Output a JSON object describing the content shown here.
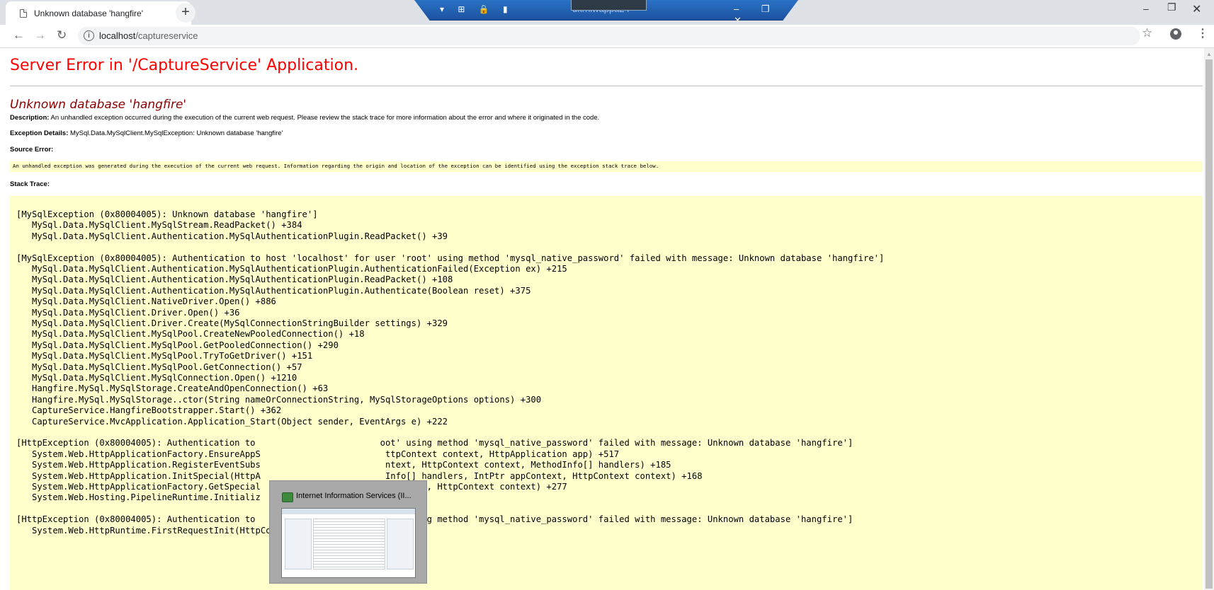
{
  "browser": {
    "tab_title": "Unknown database 'hangfire'",
    "tab_close": "×",
    "new_tab": "+",
    "window_controls": {
      "minimize": "–",
      "maximize": "❐",
      "close": "✕"
    },
    "url_host": "localhost",
    "url_path": "/captureservice",
    "icons": [
      "page-icon",
      "back-icon",
      "forward-icon",
      "reload-icon",
      "info-icon",
      "star-icon",
      "account-icon",
      "menu-icon"
    ]
  },
  "remote_bar": {
    "session_name": "ukrhiwappa24",
    "left_controls": "▾ ⊞ 🔒 ▮",
    "right_controls": "– ❐ ✕"
  },
  "page": {
    "title": "Server Error in '/CaptureService' Application.",
    "error_heading": "Unknown database 'hangfire'",
    "description_label": "Description:",
    "description_text": " An unhandled exception occurred during the execution of the current web request. Please review the stack trace for more information about the error and where it originated in the code.",
    "exception_label": "Exception Details:",
    "exception_text": " MySql.Data.MySqlClient.MySqlException: Unknown database 'hangfire'",
    "source_error_label": "Source Error:",
    "source_error_text": "An unhandled exception was generated during the execution of the current web request. Information regarding the origin and location of the exception can be identified using the exception stack trace below.",
    "stack_trace_label": "Stack Trace:",
    "stack_trace": [
      "[MySqlException (0x80004005): Unknown database 'hangfire']",
      "   MySql.Data.MySqlClient.MySqlStream.ReadPacket() +384",
      "   MySql.Data.MySqlClient.Authentication.MySqlAuthenticationPlugin.ReadPacket() +39",
      "",
      "[MySqlException (0x80004005): Authentication to host 'localhost' for user 'root' using method 'mysql_native_password' failed with message: Unknown database 'hangfire']",
      "   MySql.Data.MySqlClient.Authentication.MySqlAuthenticationPlugin.AuthenticationFailed(Exception ex) +215",
      "   MySql.Data.MySqlClient.Authentication.MySqlAuthenticationPlugin.ReadPacket() +108",
      "   MySql.Data.MySqlClient.Authentication.MySqlAuthenticationPlugin.Authenticate(Boolean reset) +375",
      "   MySql.Data.MySqlClient.NativeDriver.Open() +886",
      "   MySql.Data.MySqlClient.Driver.Open() +36",
      "   MySql.Data.MySqlClient.Driver.Create(MySqlConnectionStringBuilder settings) +329",
      "   MySql.Data.MySqlClient.MySqlPool.CreateNewPooledConnection() +18",
      "   MySql.Data.MySqlClient.MySqlPool.GetPooledConnection() +290",
      "   MySql.Data.MySqlClient.MySqlPool.TryToGetDriver() +151",
      "   MySql.Data.MySqlClient.MySqlPool.GetConnection() +57",
      "   MySql.Data.MySqlClient.MySqlConnection.Open() +1210",
      "   Hangfire.MySql.MySqlStorage.CreateAndOpenConnection() +63",
      "   Hangfire.MySql.MySqlStorage..ctor(String nameOrConnectionString, MySqlStorageOptions options) +300",
      "   CaptureService.HangfireBootstrapper.Start() +362",
      "   CaptureService.MvcApplication.Application_Start(Object sender, EventArgs e) +222",
      "",
      "[HttpException (0x80004005): Authentication to                        oot' using method 'mysql_native_password' failed with message: Unknown database 'hangfire']",
      "   System.Web.HttpApplicationFactory.EnsureAppS                        ttpContext context, HttpApplication app) +517",
      "   System.Web.HttpApplication.RegisterEventSubs                        ntext, HttpContext context, MethodInfo[] handlers) +185",
      "   System.Web.HttpApplication.InitSpecial(HttpA                        Info[] handlers, IntPtr appContext, HttpContext context) +168",
      "   System.Web.HttpApplicationFactory.GetSpecial                        pContext, HttpContext context) +277",
      "   System.Web.Hosting.PipelineRuntime.Initializ                        t) +369",
      "",
      "[HttpException (0x80004005): Authentication to                        oot' using method 'mysql_native_password' failed with message: Unknown database 'hangfire']",
      "   System.Web.HttpRuntime.FirstRequestInit(HttpContext context) +532"
    ]
  },
  "thumbnail": {
    "title": "Internet Information Services (II..."
  },
  "colors": {
    "title_red": "#ff0000",
    "heading_darkred": "#8b0000",
    "code_background": "#ffffcc",
    "rdp_blue": "#1c52a0"
  }
}
